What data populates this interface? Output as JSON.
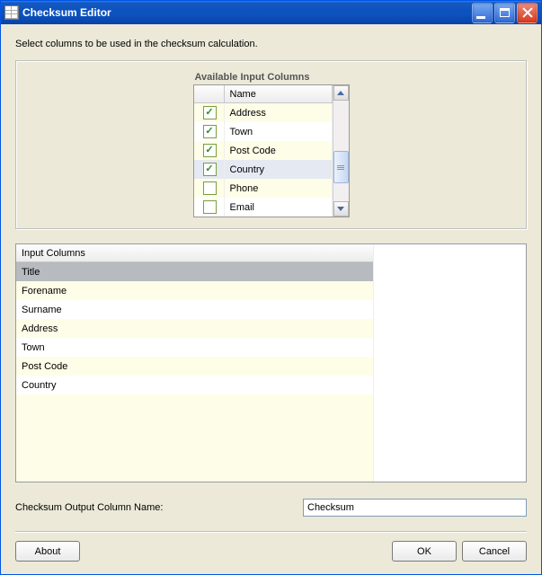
{
  "window": {
    "title": "Checksum Editor"
  },
  "instruction": "Select columns to be used in the checksum calculation.",
  "available": {
    "title": "Available Input Columns",
    "name_header": "Name",
    "rows": [
      {
        "label": "Address",
        "checked": true,
        "selected": false
      },
      {
        "label": "Town",
        "checked": true,
        "selected": false
      },
      {
        "label": "Post Code",
        "checked": true,
        "selected": false
      },
      {
        "label": "Country",
        "checked": true,
        "selected": true
      },
      {
        "label": "Phone",
        "checked": false,
        "selected": false
      },
      {
        "label": "Email",
        "checked": false,
        "selected": false
      }
    ]
  },
  "input_columns": {
    "header": "Input Columns",
    "rows": [
      {
        "label": "Title",
        "selected": true
      },
      {
        "label": "Forename",
        "selected": false
      },
      {
        "label": "Surname",
        "selected": false
      },
      {
        "label": "Address",
        "selected": false
      },
      {
        "label": "Town",
        "selected": false
      },
      {
        "label": "Post Code",
        "selected": false
      },
      {
        "label": "Country",
        "selected": false
      }
    ]
  },
  "output": {
    "label": "Checksum Output Column Name:",
    "value": "Checksum"
  },
  "buttons": {
    "about": "About",
    "ok": "OK",
    "cancel": "Cancel"
  }
}
